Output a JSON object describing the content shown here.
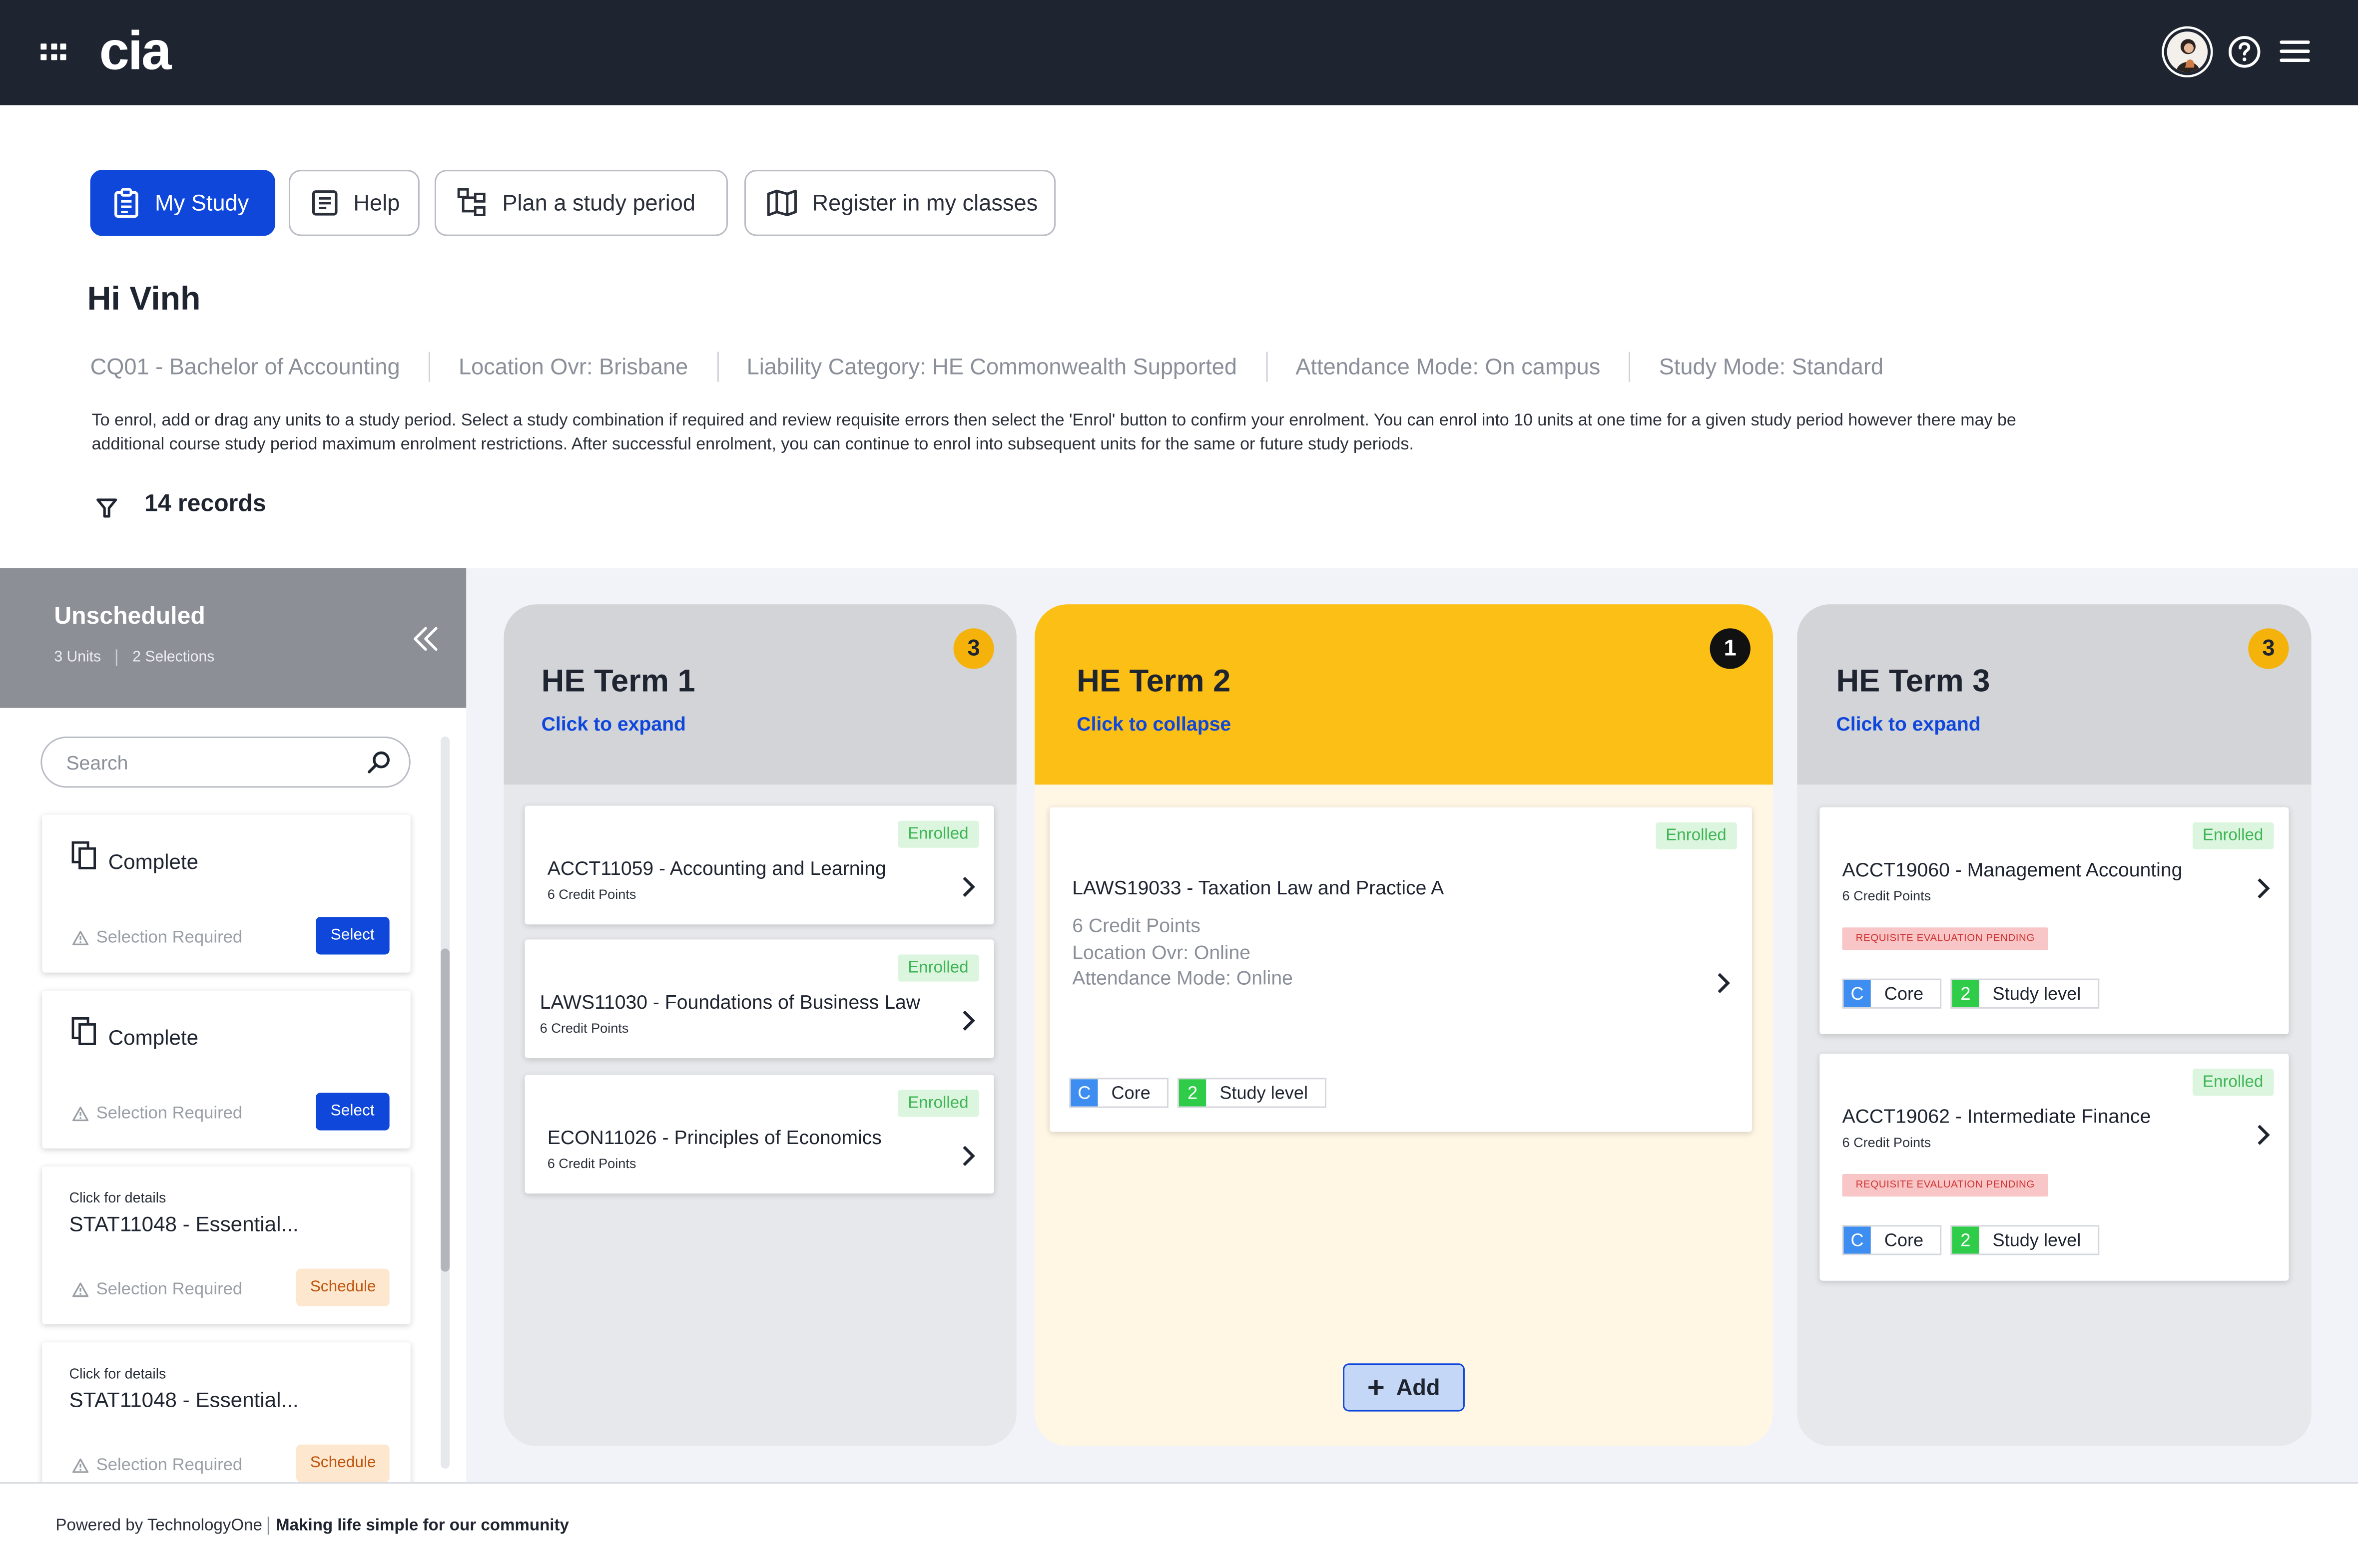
{
  "header": {
    "logo_text": "cia",
    "icons": [
      "apps-grid-icon",
      "avatar",
      "help-circle-icon",
      "hamburger-menu-icon"
    ]
  },
  "nav": {
    "my_study": "My Study",
    "help": "Help",
    "plan": "Plan a study period",
    "register": "Register in my classes"
  },
  "greeting": "Hi Vinh",
  "meta": {
    "course": "CQ01 - Bachelor of Accounting",
    "location": "Location Ovr: Brisbane",
    "liability": "Liability Category: HE Commonwealth Supported",
    "attendance": "Attendance Mode: On campus",
    "study_mode": "Study Mode: Standard"
  },
  "instructions": "To enrol, add or drag any units to a study period. Select a study combination if required and review requisite errors then select the 'Enrol' button to confirm your enrolment. You can enrol into 10 units at one time for a given study period however there may be additional course study period maximum enrolment restrictions. After successful enrolment, you can continue to enrol into subsequent units for the same or future study periods.",
  "records": "14 records",
  "unscheduled": {
    "title": "Unscheduled",
    "units": "3 Units",
    "selections": "2 Selections",
    "search_placeholder": "Search",
    "cards": [
      {
        "title": "Complete",
        "warning": "Selection Required",
        "button": "Select"
      },
      {
        "title": "Complete",
        "warning": "Selection Required",
        "button": "Select"
      },
      {
        "hint": "Click for details",
        "title": "STAT11048 - Essential...",
        "warning": "Selection Required",
        "button": "Schedule"
      },
      {
        "hint": "Click for details",
        "title": "STAT11048 - Essential...",
        "warning": "Selection Required",
        "button": "Schedule"
      }
    ]
  },
  "terms": [
    {
      "name": "HE Term 1",
      "toggle": "Click to expand",
      "count": "3",
      "units": [
        {
          "status": "Enrolled",
          "name": "ACCT11059 - Accounting and Learning",
          "credits": "6 Credit Points"
        },
        {
          "status": "Enrolled",
          "name": "LAWS11030 - Foundations of Business Law",
          "credits": "6 Credit Points"
        },
        {
          "status": "Enrolled",
          "name": "ECON11026 - Principles of Economics",
          "credits": "6 Credit Points"
        }
      ]
    },
    {
      "name": "HE Term 2",
      "toggle": "Click to collapse",
      "count": "1",
      "units": [
        {
          "status": "Enrolled",
          "name": "LAWS19033 - Taxation Law and Practice A",
          "credits": "6 Credit Points",
          "location": "Location Ovr: Online",
          "attendance": "Attendance Mode: Online",
          "chip1_letter": "C",
          "chip1_label": "Core",
          "chip2_letter": "2",
          "chip2_label": "Study level"
        }
      ],
      "add_label": "Add"
    },
    {
      "name": "HE Term 3",
      "toggle": "Click to expand",
      "count": "3",
      "units": [
        {
          "status": "Enrolled",
          "name": "ACCT19060 - Management Accounting",
          "credits": "6 Credit Points",
          "requisite": "REQUISITE EVALUATION PENDING",
          "chip1_letter": "C",
          "chip1_label": "Core",
          "chip2_letter": "2",
          "chip2_label": "Study level"
        },
        {
          "status": "Enrolled",
          "name": "ACCT19062 - Intermediate Finance",
          "credits": "6 Credit Points",
          "requisite": "REQUISITE EVALUATION PENDING",
          "chip1_letter": "C",
          "chip1_label": "Core",
          "chip2_letter": "2",
          "chip2_label": "Study level"
        }
      ]
    }
  ],
  "footer": {
    "powered": "Powered by TechnologyOne",
    "tagline": "Making life simple for our community"
  },
  "colors": {
    "topbar": "#1e2430",
    "primary": "#0f47db",
    "term_active": "#fcbf16",
    "term_inactive": "#d3d4d8",
    "enrolled_bg": "#dcf5df",
    "core_chip": "#3d8ef0",
    "level_chip": "#2fcc4a"
  }
}
